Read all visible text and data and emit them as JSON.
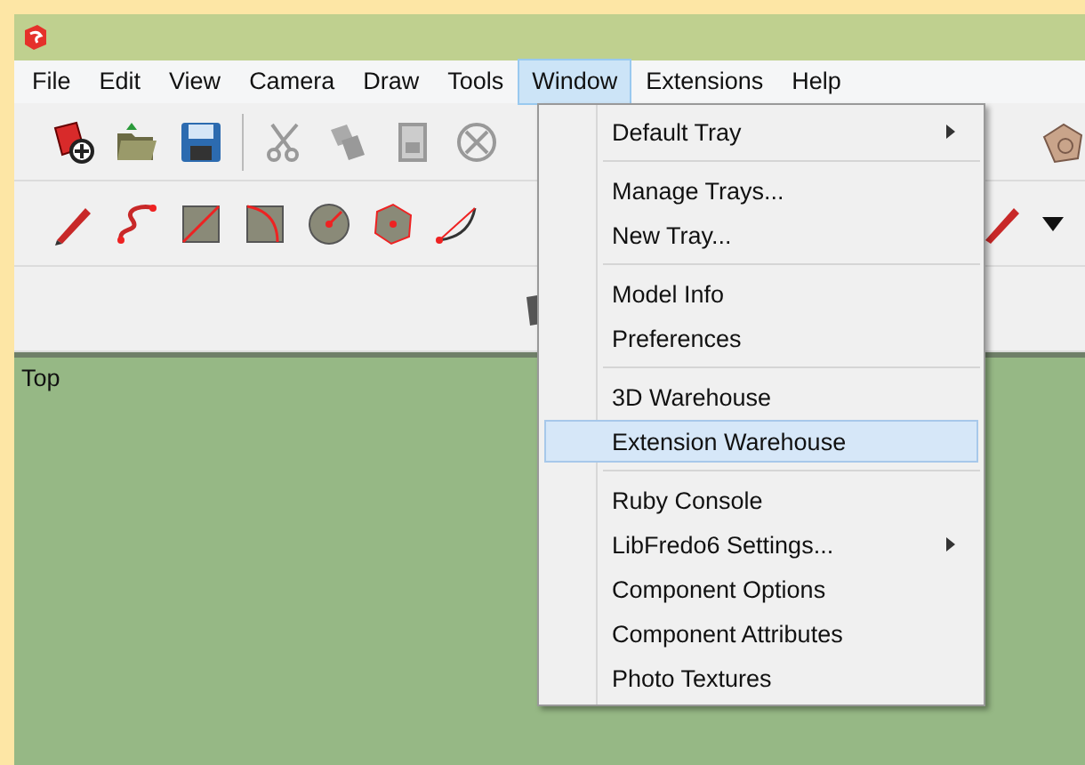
{
  "menu_bar": [
    {
      "label": "File",
      "selected": false
    },
    {
      "label": "Edit",
      "selected": false
    },
    {
      "label": "View",
      "selected": false
    },
    {
      "label": "Camera",
      "selected": false
    },
    {
      "label": "Draw",
      "selected": false
    },
    {
      "label": "Tools",
      "selected": false
    },
    {
      "label": "Window",
      "selected": true
    },
    {
      "label": "Extensions",
      "selected": false
    },
    {
      "label": "Help",
      "selected": false
    }
  ],
  "window_menu": {
    "sections": [
      [
        {
          "label": "Default Tray",
          "submenu": true,
          "selected": false
        }
      ],
      [
        {
          "label": "Manage Trays...",
          "submenu": false,
          "selected": false
        },
        {
          "label": "New Tray...",
          "submenu": false,
          "selected": false
        }
      ],
      [
        {
          "label": "Model Info",
          "submenu": false,
          "selected": false
        },
        {
          "label": "Preferences",
          "submenu": false,
          "selected": false
        }
      ],
      [
        {
          "label": "3D Warehouse",
          "submenu": false,
          "selected": false
        },
        {
          "label": "Extension Warehouse",
          "submenu": false,
          "selected": true
        }
      ],
      [
        {
          "label": "Ruby Console",
          "submenu": false,
          "selected": false
        },
        {
          "label": "LibFredo6 Settings...",
          "submenu": true,
          "selected": false
        },
        {
          "label": "Component Options",
          "submenu": false,
          "selected": false
        },
        {
          "label": "Component Attributes",
          "submenu": false,
          "selected": false
        },
        {
          "label": "Photo Textures",
          "submenu": false,
          "selected": false
        }
      ]
    ]
  },
  "viewport": {
    "view_label": "Top"
  }
}
